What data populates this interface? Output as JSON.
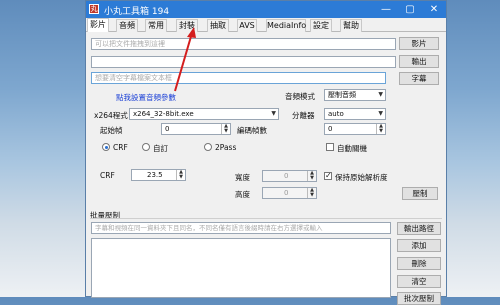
{
  "window": {
    "title": "小丸工具箱 194",
    "icon_text": "丸",
    "controls": [
      "—",
      "▢",
      "✕"
    ]
  },
  "tabs": [
    "影片",
    "音頻",
    "常用",
    "封裝",
    "抽取",
    "AVS",
    "MediaInfo",
    "設定",
    "幫助"
  ],
  "active_tab": "影片",
  "video": {
    "input_placeholder": "可以把文件拖拽到這裡",
    "input_button": "影片",
    "output_value": "",
    "output_button": "輸出",
    "subtitle_placeholder": "想要清空字幕檔案文本框",
    "subtitle_button": "字幕",
    "preset_link": "點我設置音頻參數",
    "audio_mode_label": "音頻模式",
    "audio_mode_value": "壓制音頻",
    "x264_label": "x264程式",
    "x264_value": "x264_32-8bit.exe",
    "splitter_label": "分離器",
    "splitter_value": "auto",
    "start_frame_label": "起始幀",
    "start_frame_value": "0",
    "frames_label": "編碼幀數",
    "frames_value": "0",
    "mode_crf": "CRF",
    "mode_custom": "自訂",
    "mode_2pass": "2Pass",
    "selected_mode": "CRF",
    "auto_shutdown_label": "自動關機",
    "crf_label": "CRF",
    "crf_value": "23.5",
    "width_label": "寬度",
    "width_value": "0",
    "height_label": "高度",
    "height_value": "0",
    "keep_res_label": "保持原始解析度",
    "keep_res_checked": true,
    "encode_button": "壓制"
  },
  "batch": {
    "section_label": "批量壓制",
    "hint_placeholder": "字幕和視頻在同一資料夾下且同名，不同名僅有語言後綴時請在右方選擇或輸入",
    "output_path_button": "輸出路徑",
    "add_button": "添加",
    "delete_button": "刪除",
    "clear_button": "清空",
    "encode_button": "批次壓制"
  }
}
